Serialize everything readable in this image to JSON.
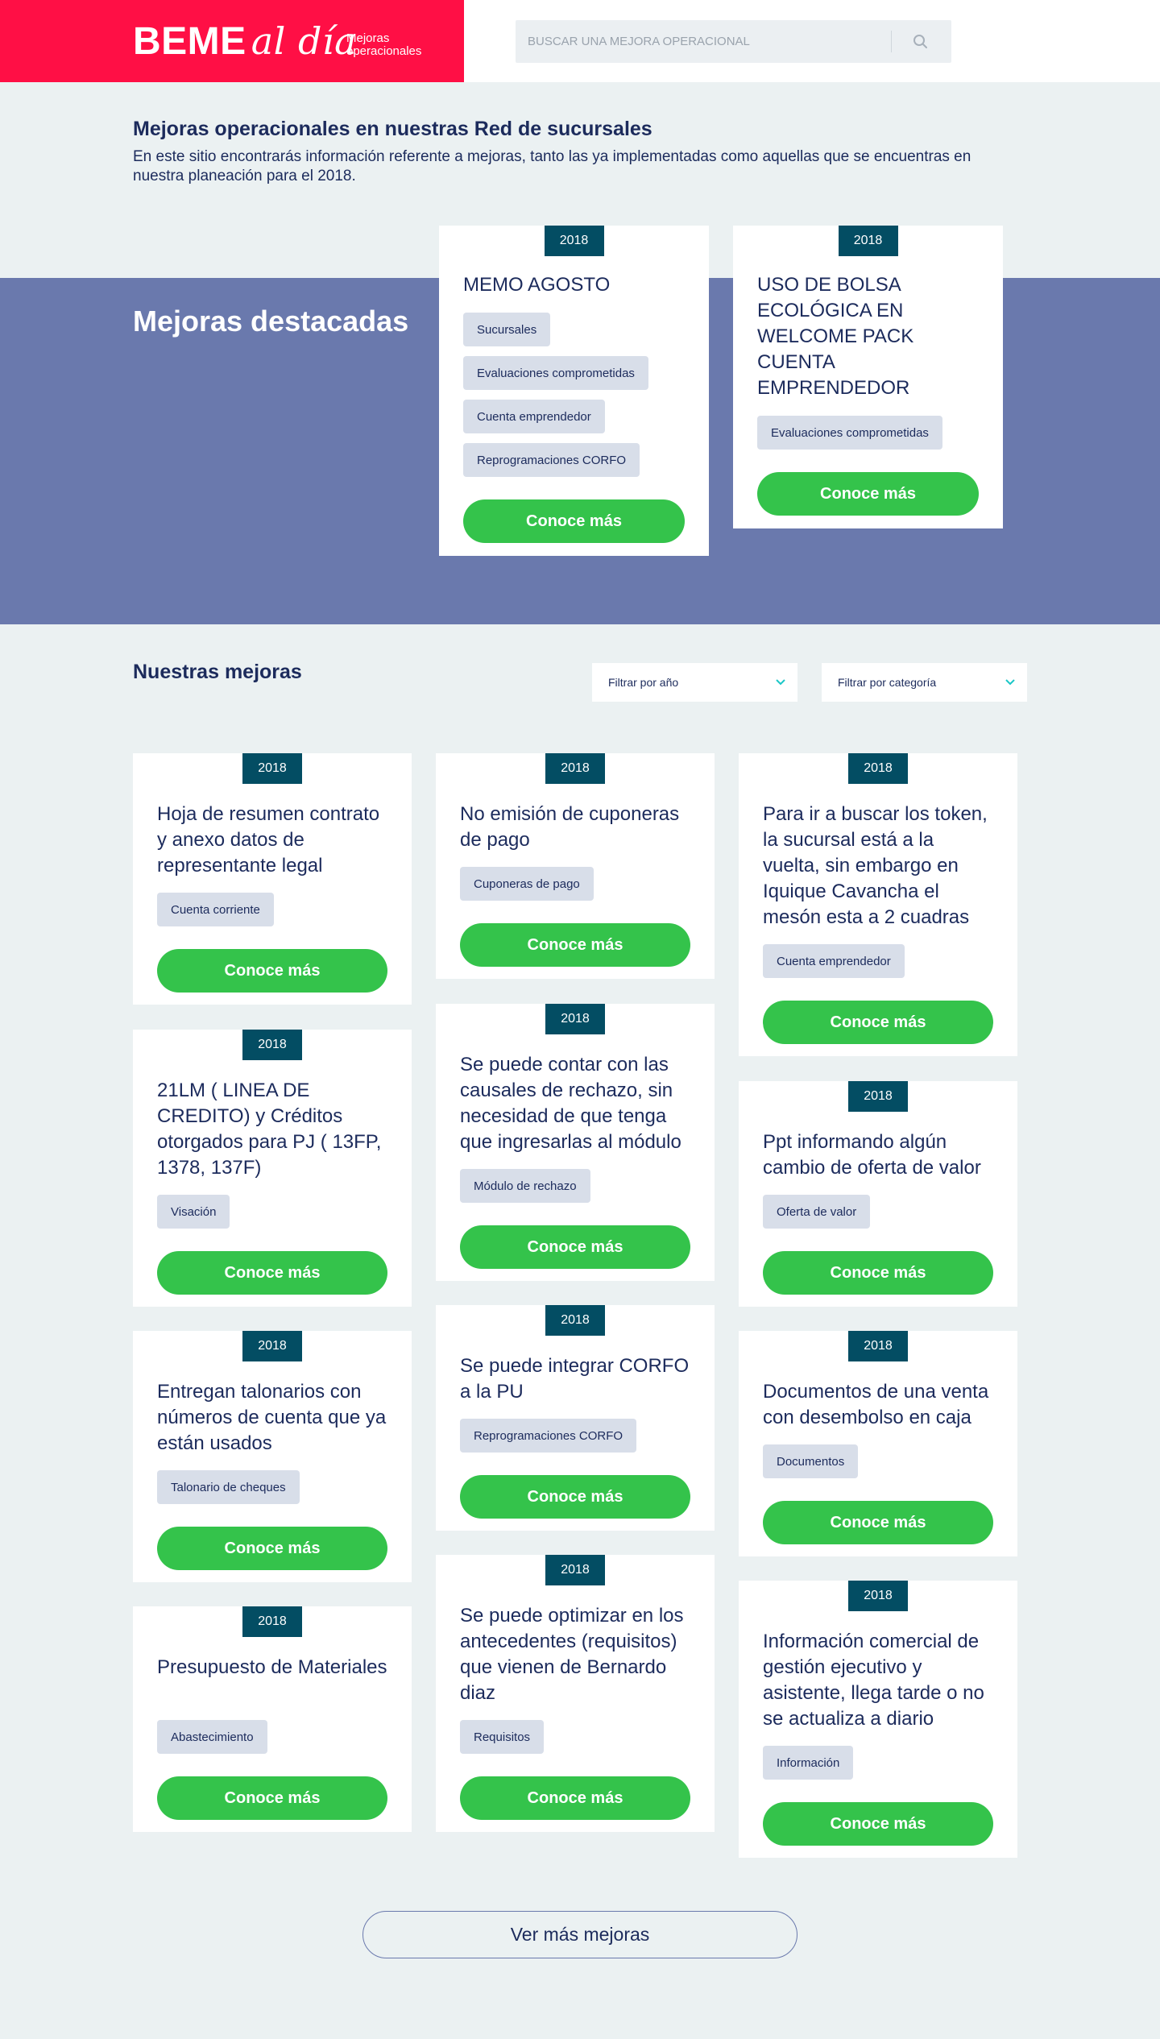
{
  "header": {
    "brand_main": "BEME",
    "brand_script": "al día",
    "brand_sub": "Mejoras operacionales",
    "search_placeholder": "BUSCAR UNA MEJORA OPERACIONAL"
  },
  "intro": {
    "title": "Mejoras operacionales en nuestras Red de sucursales",
    "text": "En este sitio encontrarás información referente a mejoras, tanto las ya implementadas como aquellas que se encuentras en nuestra planeación para el 2018."
  },
  "featured": {
    "title": "Mejoras destacadas",
    "cards": [
      {
        "year": "2018",
        "title": "MEMO AGOSTO",
        "tags": [
          "Sucursales",
          "Evaluaciones comprometidas",
          "Cuenta emprendedor",
          "Reprogramaciones CORFO"
        ],
        "button": "Conoce más"
      },
      {
        "year": "2018",
        "title": "USO DE BOLSA ECOLÓGICA EN WELCOME PACK CUENTA EMPRENDEDOR",
        "tags": [
          "Evaluaciones comprometidas"
        ],
        "button": "Conoce más"
      }
    ]
  },
  "improvements": {
    "title": "Nuestras mejoras",
    "filter_year": "Filtrar por año",
    "filter_category": "Filtrar por categoría",
    "cards": [
      {
        "year": "2018",
        "title": "Hoja de resumen contrato y anexo datos de representante legal",
        "tag": "Cuenta corriente",
        "button": "Conoce más"
      },
      {
        "year": "2018",
        "title": "No emisión de cuponeras de pago",
        "tag": "Cuponeras de pago",
        "button": "Conoce más"
      },
      {
        "year": "2018",
        "title": "Para ir a buscar los token, la sucursal está a la vuelta, sin embargo en Iquique Cavancha el mesón esta a 2 cuadras",
        "tag": "Cuenta emprendedor",
        "button": "Conoce más"
      },
      {
        "year": "2018",
        "title": "21LM ( LINEA DE CREDITO) y Créditos otorgados para PJ ( 13FP, 1378, 137F)",
        "tag": "Visación",
        "button": "Conoce más"
      },
      {
        "year": "2018",
        "title": "Se puede contar con las causales de rechazo, sin necesidad de que tenga que ingresarlas al módulo",
        "tag": "Módulo de rechazo",
        "button": "Conoce más"
      },
      {
        "year": "2018",
        "title": "Ppt informando algún cambio de oferta de valor",
        "tag": "Oferta de valor",
        "button": "Conoce más"
      },
      {
        "year": "2018",
        "title": "Entregan talonarios con números de cuenta que ya están usados",
        "tag": "Talonario de cheques",
        "button": "Conoce más"
      },
      {
        "year": "2018",
        "title": "Se puede integrar CORFO a la PU",
        "tag": "Reprogramaciones CORFO",
        "button": "Conoce más"
      },
      {
        "year": "2018",
        "title": "Documentos de una venta con desembolso en caja",
        "tag": "Documentos",
        "button": "Conoce más"
      },
      {
        "year": "2018",
        "title": "Presupuesto de Materiales",
        "tag": "Abastecimiento",
        "button": "Conoce más"
      },
      {
        "year": "2018",
        "title": "Se puede optimizar en los antecedentes (requisitos) que vienen de Bernardo diaz",
        "tag": "Requisitos",
        "button": "Conoce más"
      },
      {
        "year": "2018",
        "title": "Información comercial de gestión ejecutivo y asistente, llega tarde o no se actualiza a diario",
        "tag": "Información",
        "button": "Conoce más"
      }
    ],
    "more_button": "Ver más mejoras"
  }
}
